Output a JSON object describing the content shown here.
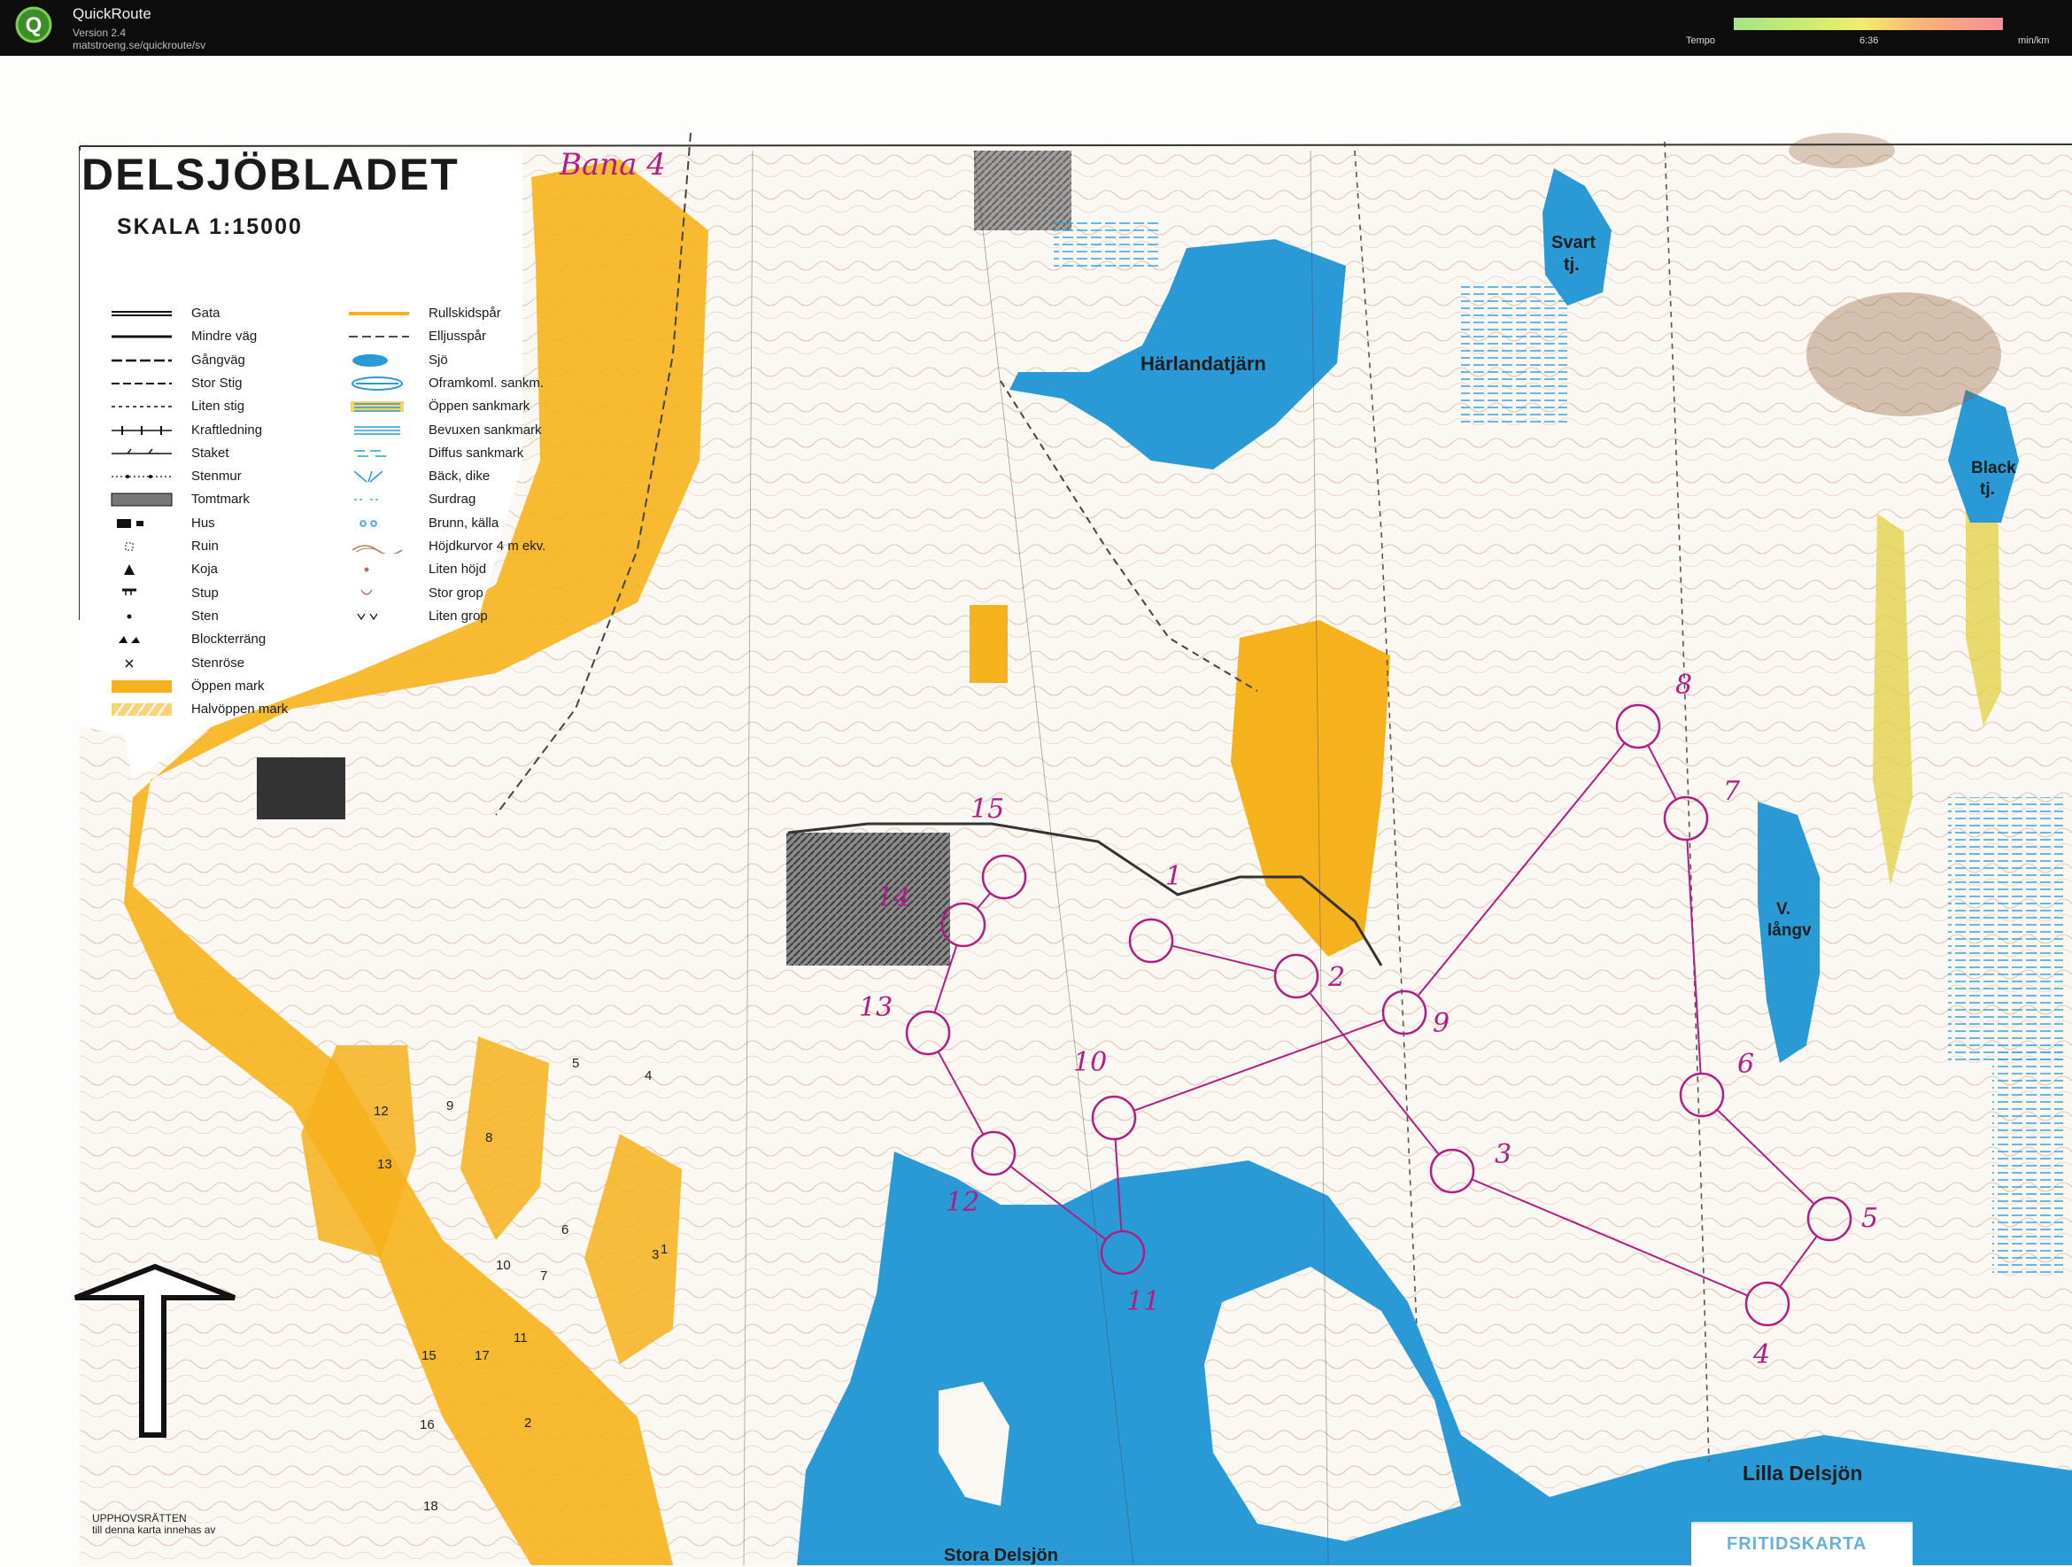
{
  "app": {
    "title": "QuickRoute",
    "version": "Version 2.4",
    "url": "matstroeng.se/quickroute/sv",
    "logo_letter": "Q"
  },
  "tempo": {
    "label": "Tempo",
    "middle_value": "6:36",
    "unit": "min/km",
    "colors": [
      "#a7e38a",
      "#c9eb73",
      "#f3ec6e",
      "#f8b27a",
      "#f58f97"
    ]
  },
  "map": {
    "title": "DELSJÖBLADET",
    "scale": "SKALA 1:15000",
    "course_label": "Bana 4",
    "colors": {
      "water": "#2a9ad6",
      "open_land": "#f6b21c",
      "course": "#b01e84",
      "contour": "#b07a5a"
    },
    "legend": [
      {
        "label": "Gata",
        "icon": "double-line-icon"
      },
      {
        "label": "Mindre väg",
        "icon": "road-icon"
      },
      {
        "label": "Gångväg",
        "icon": "dashed-road-icon"
      },
      {
        "label": "Stor Stig",
        "icon": "big-path-icon"
      },
      {
        "label": "Liten stig",
        "icon": "small-path-icon"
      },
      {
        "label": "Kraftledning",
        "icon": "power-line-icon"
      },
      {
        "label": "Staket",
        "icon": "fence-icon"
      },
      {
        "label": "Stenmur",
        "icon": "stone-wall-icon"
      },
      {
        "label": "Tomtmark",
        "icon": "settlement-icon"
      },
      {
        "label": "Hus",
        "icon": "house-icon"
      },
      {
        "label": "Ruin",
        "icon": "ruin-icon"
      },
      {
        "label": "Koja",
        "icon": "hut-icon"
      },
      {
        "label": "Stup",
        "icon": "cliff-icon"
      },
      {
        "label": "Sten",
        "icon": "boulder-icon"
      },
      {
        "label": "Blockterräng",
        "icon": "boulder-field-icon"
      },
      {
        "label": "Stenröse",
        "icon": "cairn-icon"
      },
      {
        "label": "Öppen mark",
        "icon": "open-land-icon"
      },
      {
        "label": "Halvöppen mark",
        "icon": "semi-open-icon"
      },
      {
        "label": "Rullskidspår",
        "icon": "roller-ski-icon"
      },
      {
        "label": "Elljusspår",
        "icon": "lit-track-icon"
      },
      {
        "label": "Sjö",
        "icon": "lake-icon"
      },
      {
        "label": "Oframkoml. sankm.",
        "icon": "impassable-marsh-icon"
      },
      {
        "label": "Öppen sankmark",
        "icon": "open-marsh-icon"
      },
      {
        "label": "Bevuxen sankmark",
        "icon": "vegetated-marsh-icon"
      },
      {
        "label": "Diffus sankmark",
        "icon": "diffuse-marsh-icon"
      },
      {
        "label": "Bäck, dike",
        "icon": "stream-icon"
      },
      {
        "label": "Surdrag",
        "icon": "seepage-icon"
      },
      {
        "label": "Brunn, källa",
        "icon": "spring-icon"
      },
      {
        "label": "Höjdkurvor 4 m ekv.",
        "icon": "contour-icon"
      },
      {
        "label": "Liten höjd",
        "icon": "knoll-icon"
      },
      {
        "label": "Stor grop",
        "icon": "big-pit-icon"
      },
      {
        "label": "Liten grop",
        "icon": "small-pit-icon"
      }
    ],
    "place_names": {
      "harlandatjarn": "Härlandatjärn",
      "svart_1": "Svart",
      "svart_2": "tj.",
      "black_1": "Black",
      "black_2": "tj.",
      "v_langv_1": "V.",
      "v_langv_2": "långv",
      "lilla_delsjon": "Lilla Delsjön",
      "stora_delsjon": "Stora Delsjön",
      "fritidskarta": "FRITIDSKARTA"
    },
    "copyright_1": "UPPHOVSRÄTTEN",
    "copyright_2": "till denna karta innehas av",
    "controls": [
      "1",
      "2",
      "3",
      "4",
      "5",
      "6",
      "7",
      "8",
      "9",
      "10",
      "11",
      "12",
      "13",
      "14",
      "15"
    ],
    "area_numbers": [
      "1",
      "2",
      "3",
      "4",
      "5",
      "6",
      "7",
      "8",
      "9",
      "10",
      "11",
      "12",
      "13",
      "15",
      "16",
      "17",
      "18"
    ]
  }
}
